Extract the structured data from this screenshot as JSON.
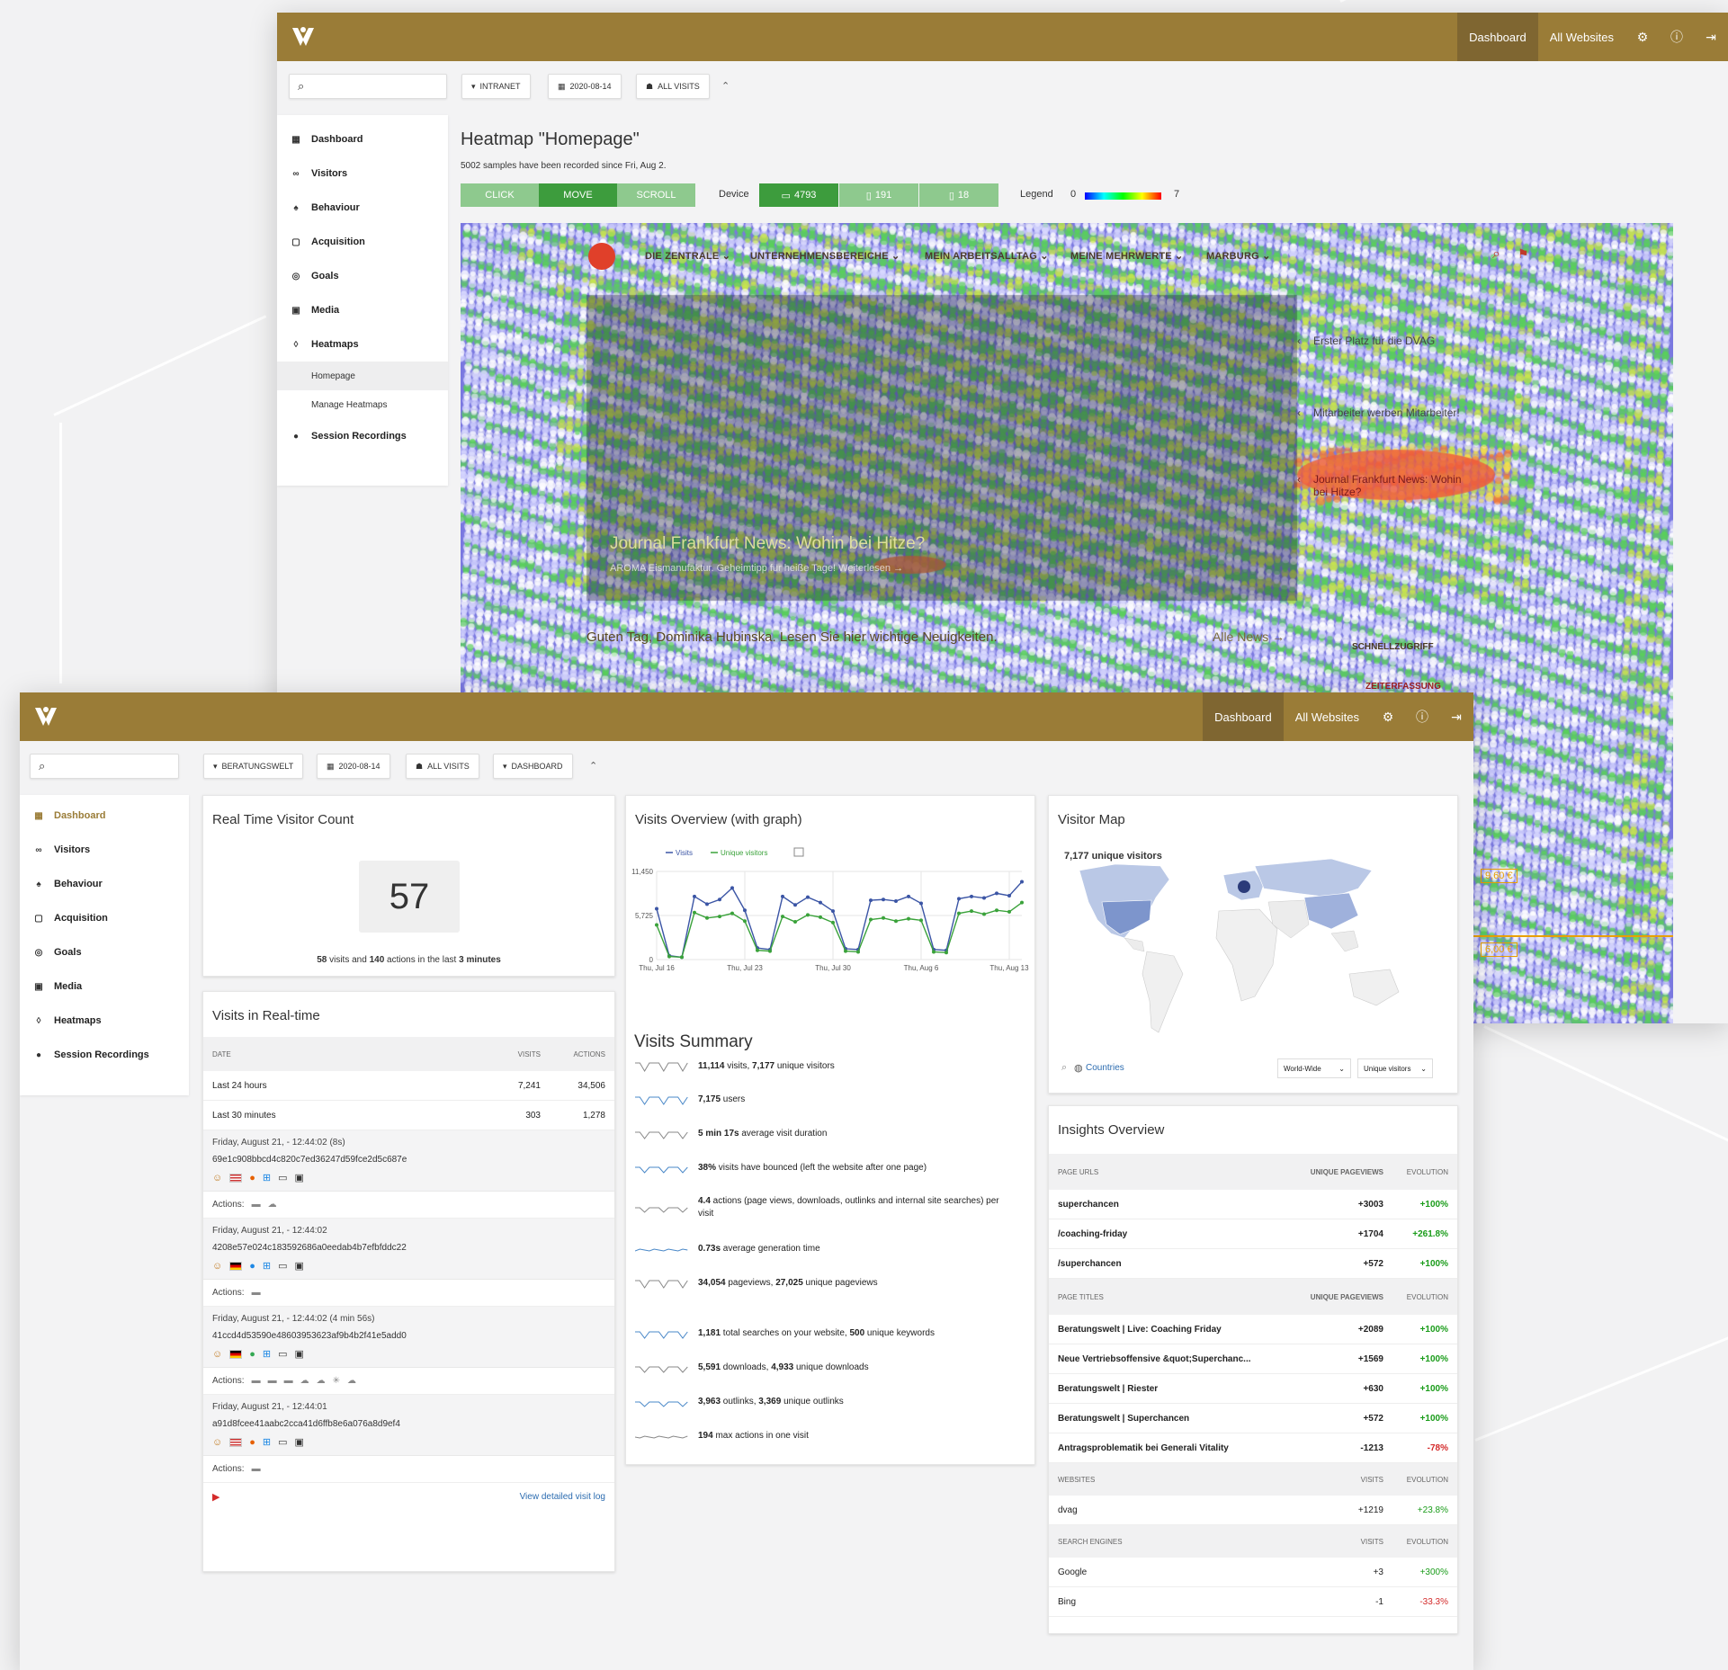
{
  "back_window": {
    "topbar": {
      "dashboard": "Dashboard",
      "all_websites": "All Websites"
    },
    "filters": {
      "site": "INTRANET",
      "date": "2020-08-14",
      "segment": "ALL VISITS"
    },
    "sidebar": [
      {
        "icon": "grid-icon",
        "label": "Dashboard"
      },
      {
        "icon": "binoculars-icon",
        "label": "Visitors"
      },
      {
        "icon": "bell-icon",
        "label": "Behaviour"
      },
      {
        "icon": "acquisition-icon",
        "label": "Acquisition"
      },
      {
        "icon": "target-icon",
        "label": "Goals"
      },
      {
        "icon": "media-icon",
        "label": "Media"
      },
      {
        "icon": "drop-icon",
        "label": "Heatmaps"
      }
    ],
    "sidebar_sub": [
      "Homepage",
      "Manage Heatmaps"
    ],
    "sidebar_last": "Session Recordings",
    "heatmap": {
      "title": "Heatmap \"Homepage\"",
      "subtitle": "5002 samples have been recorded since Fri, Aug 2.",
      "modes": [
        "CLICK",
        "MOVE",
        "SCROLL"
      ],
      "active_mode": "MOVE",
      "device_label": "Device",
      "devices": [
        {
          "icon": "desktop-icon",
          "count": "4793"
        },
        {
          "icon": "tablet-icon",
          "count": "191"
        },
        {
          "icon": "phone-icon",
          "count": "18"
        }
      ],
      "legend_label": "Legend",
      "legend_min": "0",
      "legend_max": "7",
      "site_nav": [
        "DIE ZENTRALE",
        "UNTERNEHMENSBEREICHE",
        "MEIN ARBEITSALLTAG",
        "MEINE MEHRWERTE",
        "MARBURG"
      ],
      "side_news": [
        "Erster Platz für die DVAG",
        "Mitarbeiter werben Mitarbeiter!",
        "Journal Frankfurt News: Wohin bei Hitze?"
      ],
      "hero_title": "Journal Frankfurt News: Wohin bei Hitze?",
      "hero_sub": "AROMA Eismanufaktur. Geheimtipp für heiße Tage! Weiterlesen →",
      "greeting": "Guten Tag, Dominika Hubinska. Lesen Sie hier wichtige Neuigkeiten.",
      "all_news": "Alle News →",
      "quick": [
        "SCHNELLZUGRIFF",
        "ZEITERFASSUNG"
      ],
      "price1": "9,60 €",
      "price2": "6,00 €"
    }
  },
  "front_window": {
    "topbar": {
      "dashboard": "Dashboard",
      "all_websites": "All Websites"
    },
    "filters": {
      "site": "BERATUNGSWELT",
      "date": "2020-08-14",
      "segment": "ALL VISITS",
      "dashboard": "DASHBOARD"
    },
    "sidebar": [
      {
        "icon": "grid-icon",
        "label": "Dashboard"
      },
      {
        "icon": "binoculars-icon",
        "label": "Visitors"
      },
      {
        "icon": "bell-icon",
        "label": "Behaviour"
      },
      {
        "icon": "acquisition-icon",
        "label": "Acquisition"
      },
      {
        "icon": "target-icon",
        "label": "Goals"
      },
      {
        "icon": "media-icon",
        "label": "Media"
      },
      {
        "icon": "drop-icon",
        "label": "Heatmaps"
      },
      {
        "icon": "play-icon",
        "label": "Session Recordings"
      }
    ],
    "realtime": {
      "title": "Real Time Visitor Count",
      "count": "57",
      "visits": "58",
      "visits_txt": "visits",
      "and": "and",
      "actions": "140",
      "actions_txt": "actions",
      "in_last": "in the last",
      "minutes": "3",
      "minutes_txt": "minutes"
    },
    "visits_rt": {
      "title": "Visits in Real-time",
      "headers": [
        "DATE",
        "VISITS",
        "ACTIONS"
      ],
      "rows": [
        [
          "Last 24 hours",
          "7,241",
          "34,506"
        ],
        [
          "Last 30 minutes",
          "303",
          "1,278"
        ]
      ],
      "visits": [
        {
          "time": "Friday, August 21, - 12:44:02 (8s)",
          "id": "69e1c908bbcd4c820c7ed36247d59fce2d5c687e",
          "browser": "firefox",
          "flag": "us",
          "actions": 2
        },
        {
          "time": "Friday, August 21, - 12:44:02",
          "id": "4208e57e024c183592686a0eedab4b7efbfddc22",
          "browser": "edge",
          "flag": "de",
          "actions": 1
        },
        {
          "time": "Friday, August 21, - 12:44:02 (4 min 56s)",
          "id": "41ccd4d53590e48603953623af9b4b2f41e5add0",
          "browser": "chrome",
          "flag": "de",
          "actions": 7
        },
        {
          "time": "Friday, August 21, - 12:44:01",
          "id": "a91d8fcee41aabc2cca41d6ffb8e6a076a8d9ef4",
          "browser": "firefox",
          "flag": "us",
          "actions": 1
        }
      ],
      "actions_label": "Actions:",
      "footer_link": "View detailed visit log"
    },
    "overview": {
      "title": "Visits Overview (with graph)",
      "legend": [
        "Visits",
        "Unique visitors"
      ],
      "colors": [
        "#3b55a5",
        "#3aa23a"
      ]
    },
    "chart_data": {
      "type": "line",
      "x": [
        "Thu, Jul 16",
        "",
        "",
        "",
        "",
        "",
        "",
        "Thu, Jul 23",
        "",
        "",
        "",
        "",
        "",
        "",
        "Thu, Jul 30",
        "",
        "",
        "",
        "",
        "",
        "",
        "Thu, Aug 6",
        "",
        "",
        "",
        "",
        "",
        "",
        "Thu, Aug 13",
        ""
      ],
      "xticks": [
        "Thu, Jul 16",
        "Thu, Jul 23",
        "Thu, Jul 30",
        "Thu, Aug 6",
        "Thu, Aug 13"
      ],
      "yticks": [
        "0",
        "5,725",
        "11,450"
      ],
      "ylim": [
        0,
        11450
      ],
      "series": [
        {
          "name": "Visits",
          "values": [
            6600,
            500,
            300,
            8200,
            7200,
            7800,
            9300,
            6400,
            1500,
            1300,
            8200,
            7100,
            8100,
            7400,
            6300,
            1400,
            1300,
            7700,
            7800,
            7600,
            8200,
            7300,
            1300,
            1200,
            7900,
            8200,
            8000,
            8600,
            8300,
            10100
          ]
        },
        {
          "name": "Unique visitors",
          "values": [
            4500,
            400,
            300,
            6100,
            5400,
            5600,
            6000,
            5000,
            1200,
            1100,
            5600,
            4900,
            5800,
            5500,
            4800,
            1100,
            1000,
            5200,
            5400,
            5000,
            5300,
            5100,
            1000,
            900,
            6000,
            6300,
            5900,
            6400,
            6200,
            7400
          ]
        }
      ]
    },
    "summary": {
      "title": "Visits Summary",
      "rows": [
        {
          "b1": "11,114",
          "t1": " visits, ",
          "b2": "7,177",
          "t2": " unique visitors"
        },
        {
          "b1": "7,175",
          "t1": " users",
          "b2": "",
          "t2": ""
        },
        {
          "b1": "5 min 17s",
          "t1": " average visit duration",
          "b2": "",
          "t2": ""
        },
        {
          "b1": "38%",
          "t1": " visits have bounced (left the website after one page)",
          "b2": "",
          "t2": ""
        },
        {
          "b1": "4.4",
          "t1": " actions (page views, downloads, outlinks and internal site searches) per visit",
          "b2": "",
          "t2": ""
        },
        {
          "b1": "0.73s",
          "t1": " average generation time",
          "b2": "",
          "t2": ""
        },
        {
          "b1": "34,054",
          "t1": " pageviews, ",
          "b2": "27,025",
          "t2": " unique pageviews"
        },
        {
          "b1": "1,181",
          "t1": " total searches on your website, ",
          "b2": "500",
          "t2": " unique keywords"
        },
        {
          "b1": "5,591",
          "t1": " downloads, ",
          "b2": "4,933",
          "t2": " unique downloads"
        },
        {
          "b1": "3,963",
          "t1": " outlinks, ",
          "b2": "3,369",
          "t2": " unique outlinks"
        },
        {
          "b1": "194",
          "t1": " max actions in one visit",
          "b2": "",
          "t2": ""
        }
      ]
    },
    "map": {
      "title": "Visitor Map",
      "unique": "7,177 unique visitors",
      "countries": "Countries",
      "region": "World-Wide",
      "metric": "Unique visitors"
    },
    "insights": {
      "title": "Insights Overview",
      "sections": [
        {
          "headers": [
            "PAGE URLS",
            "UNIQUE PAGEVIEWS",
            "EVOLUTION"
          ],
          "bold": true,
          "rows": [
            [
              "superchancen",
              "+3003",
              "+100%",
              "pos"
            ],
            [
              "/coaching-friday",
              "+1704",
              "+261.8%",
              "pos"
            ],
            [
              "/superchancen",
              "+572",
              "+100%",
              "pos"
            ]
          ]
        },
        {
          "headers": [
            "PAGE TITLES",
            "UNIQUE PAGEVIEWS",
            "EVOLUTION"
          ],
          "bold": true,
          "rows": [
            [
              "Beratungswelt | Live: Coaching Friday",
              "+2089",
              "+100%",
              "pos"
            ],
            [
              "Neue Vertriebsoffensive &quot;Superchanc...",
              "+1569",
              "+100%",
              "pos"
            ],
            [
              "Beratungswelt | Riester",
              "+630",
              "+100%",
              "pos"
            ],
            [
              "Beratungswelt | Superchancen",
              "+572",
              "+100%",
              "pos"
            ],
            [
              "Antragsproblematik bei Generali Vitality",
              "-1213",
              "-78%",
              "neg"
            ]
          ]
        },
        {
          "headers": [
            "WEBSITES",
            "VISITS",
            "EVOLUTION"
          ],
          "bold": false,
          "rows": [
            [
              "dvag",
              "+1219",
              "+23.8%",
              "pos"
            ]
          ]
        },
        {
          "headers": [
            "SEARCH ENGINES",
            "VISITS",
            "EVOLUTION"
          ],
          "bold": false,
          "rows": [
            [
              "Google",
              "+3",
              "+300%",
              "pos"
            ],
            [
              "Bing",
              "-1",
              "-33.3%",
              "neg"
            ]
          ]
        }
      ]
    }
  }
}
